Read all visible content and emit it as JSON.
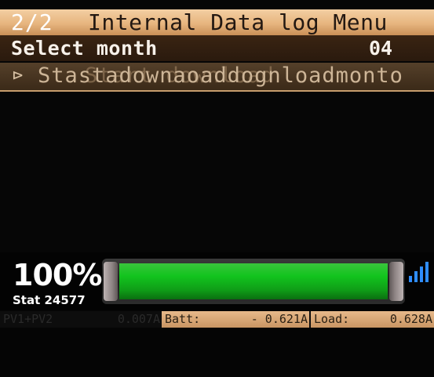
{
  "menu": {
    "page_indicator": "2/2",
    "title": "Internal Data log Menu"
  },
  "select_row": {
    "label": "Select month",
    "value": "04"
  },
  "action_row": {
    "arrow": "⊳",
    "text": "Stastadownaoaddognloadmonto",
    "ghost_text": "Start download"
  },
  "status": {
    "percent_label": "100%",
    "percent_value": 100,
    "stat_label": "Stat 24577",
    "signal_icon": "signal-bars-icon"
  },
  "readouts": {
    "pv_label": "PV1+PV2",
    "pv_value": "0.007A",
    "batt_label": "Batt:",
    "batt_value": "- 0.621A",
    "load_label": "Load:",
    "load_value": "0.628A"
  },
  "colors": {
    "title_bar": "#e7b57f",
    "battery_fill": "#12c41e",
    "signal": "#2f8dff"
  }
}
